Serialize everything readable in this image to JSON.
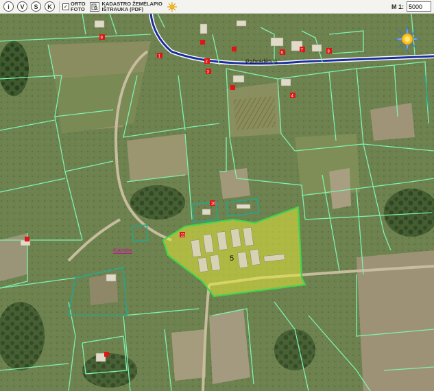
{
  "toolbar": {
    "buttons": [
      {
        "key": "i",
        "label": "i"
      },
      {
        "key": "v",
        "label": "V"
      },
      {
        "key": "s",
        "label": "S"
      },
      {
        "key": "k",
        "label": "K"
      }
    ],
    "orto_checkbox": {
      "checked": true,
      "mark": "✓",
      "line1": "ORTO",
      "line2": "FOTO"
    },
    "kadastro": {
      "line1": "KADASTRO ŽEMĖLAPIO",
      "line2": "IŠTRAUKA (PDF)"
    },
    "scale": {
      "label": "M 1:",
      "value": "5000"
    }
  },
  "map": {
    "street_label": "Pabradės g.",
    "place_label": "Karolis",
    "selected_parcel_number": "5",
    "parcel_numbers": [
      "1",
      "2",
      "3",
      "4",
      "6",
      "7",
      "8",
      "9",
      "10",
      "11"
    ],
    "colors": {
      "road": "#1a2f9c",
      "parcel_border": "#7ff2b0",
      "selected_fill": "#e4e83a",
      "selected_border": "#3fd64c",
      "marker": "#e01616",
      "place_label": "#c0188a"
    }
  }
}
